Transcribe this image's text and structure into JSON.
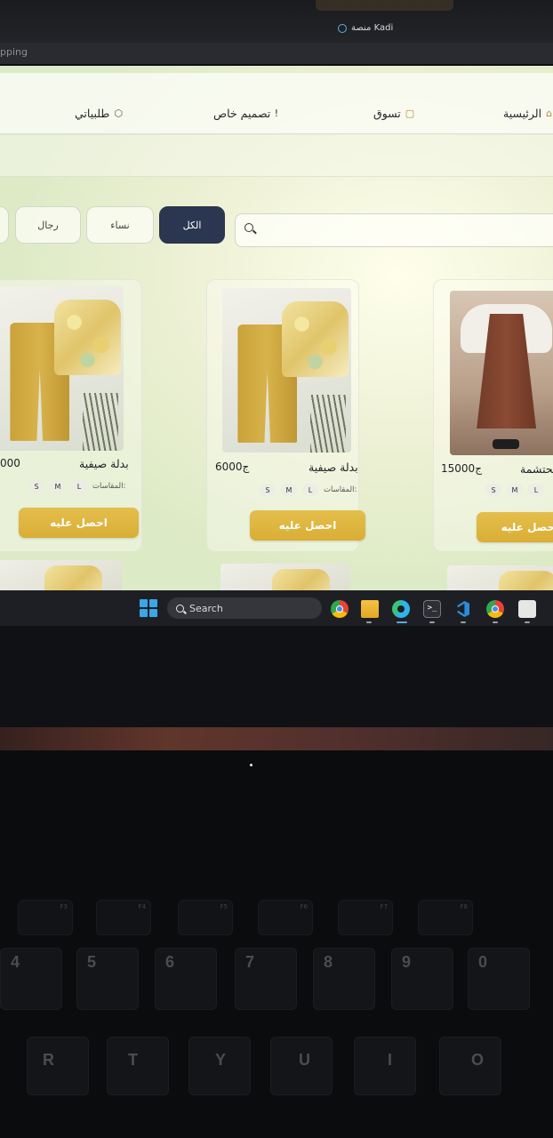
{
  "window": {
    "title": "منصة Kadi"
  },
  "urlbar": {
    "text": "pping"
  },
  "nav": {
    "home": "الرئيسية",
    "shop": "تسوق",
    "custom_design": "تصميم خاص",
    "my_orders": "طلبياتي"
  },
  "filters": {
    "all": "الكل",
    "women": "نساء",
    "men": "رجال"
  },
  "search": {
    "placeholder": ""
  },
  "products": [
    {
      "name": "بدلة صيفية",
      "price": "000",
      "sizes_label": "المقاسات:",
      "sizes": [
        "L",
        "M",
        "S"
      ],
      "cta": "احصل عليه"
    },
    {
      "name": "بدلة صيفية",
      "price": "6000ج",
      "sizes_label": "المقاسات:",
      "sizes": [
        "L",
        "M",
        "S"
      ],
      "cta": "احصل عليه"
    },
    {
      "name": "محتشمة",
      "price": "15000ج",
      "sizes_label": "",
      "sizes": [
        "L",
        "M",
        "S"
      ],
      "cta": "احصل عليه"
    }
  ],
  "taskbar": {
    "search_label": "Search",
    "apps": [
      "chrome-icon",
      "file-explorer-icon",
      "edge-icon",
      "terminal-icon",
      "vscode-icon",
      "chrome-profile-icon",
      "snipping-icon"
    ]
  },
  "keyboard": {
    "fn_row": [
      "F3",
      "F4",
      "F5",
      "F6",
      "F7",
      "F8"
    ],
    "number_row": [
      "4",
      "5",
      "6",
      "7",
      "8",
      "9",
      "0"
    ],
    "letter_row": [
      "R",
      "T",
      "Y",
      "U",
      "I",
      "O"
    ]
  },
  "colors": {
    "accent_gold": "#d9ae35",
    "active_filter": "#2b3650",
    "taskbar": "#1e1f24"
  }
}
